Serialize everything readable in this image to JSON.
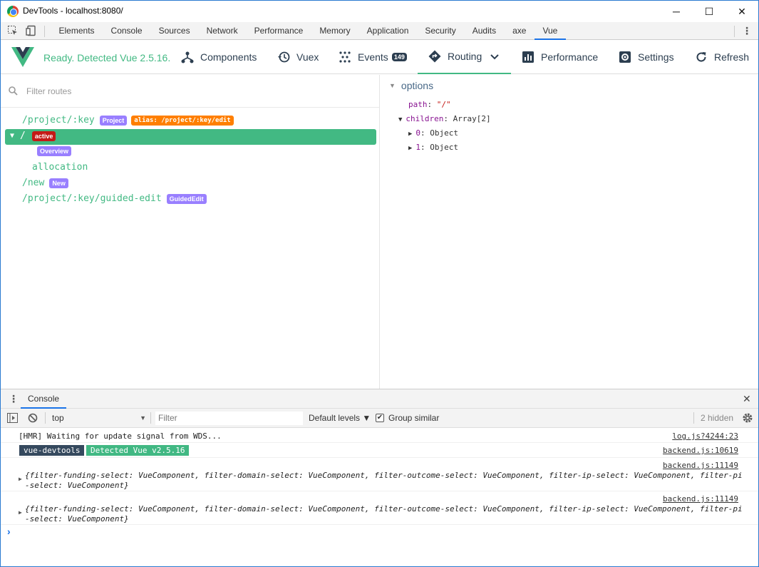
{
  "window": {
    "title": "DevTools - localhost:8080/",
    "minimize": "─",
    "maximize": "☐",
    "close": "✕"
  },
  "devtools_tabs": [
    "Elements",
    "Console",
    "Sources",
    "Network",
    "Performance",
    "Memory",
    "Application",
    "Security",
    "Audits",
    "axe",
    "Vue"
  ],
  "devtools_selected_tab": "Vue",
  "vue_header": {
    "status": "Ready. Detected Vue 2.5.16.",
    "nav": {
      "components": "Components",
      "vuex": "Vuex",
      "events": "Events",
      "events_count": "149",
      "routing": "Routing",
      "performance": "Performance",
      "settings": "Settings",
      "refresh": "Refresh"
    }
  },
  "routes": {
    "filter_placeholder": "Filter routes",
    "items": [
      {
        "path": "/project/:key",
        "tags": [
          "Project"
        ],
        "alias": "alias: /project/:key/edit"
      },
      {
        "path": "/",
        "tag": "active"
      },
      {
        "path": "",
        "tag": "Overview"
      },
      {
        "path": "allocation"
      },
      {
        "path": "/new",
        "tag": "New"
      },
      {
        "path": "/project/:key/guided-edit",
        "tag": "GuidedEdit"
      }
    ]
  },
  "inspector": {
    "section": "options",
    "path_key": "path",
    "path_value": "\"/\"",
    "children_key": "children",
    "children_value": "Array[2]",
    "child0_key": "0",
    "child0_value": "Object",
    "child1_key": "1",
    "child1_value": "Object"
  },
  "console": {
    "tab": "Console",
    "context": "top",
    "filter_placeholder": "Filter",
    "levels": "Default levels ▼",
    "group_similar": "Group similar",
    "hidden": "2 hidden",
    "messages": [
      {
        "text": "[HMR] Waiting for update signal from WDS...",
        "source": "log.js?4244:23"
      },
      {
        "badge1": "vue-devtools",
        "badge2": "Detected Vue v2.5.16",
        "source": "backend.js:10619"
      },
      {
        "line1": "{filter-funding-select: VueComponent, filter-domain-select: VueComponent, filter-outcome-select: VueComponent, filter-ip-select: VueComponent, filter-pi",
        "line2": "-select: VueComponent}",
        "source": "backend.js:11149"
      },
      {
        "line1": "{filter-funding-select: VueComponent, filter-domain-select: VueComponent, filter-outcome-select: VueComponent, filter-ip-select: VueComponent, filter-pi",
        "line2": "-select: VueComponent}",
        "source": "backend.js:11149"
      }
    ],
    "prompt": "›"
  },
  "colors": {
    "vue_green": "#42b983",
    "vue_dark": "#2c3e50",
    "tag_purple": "#997fff",
    "tag_orange": "#ff7f00",
    "tag_red": "#c41a16"
  }
}
